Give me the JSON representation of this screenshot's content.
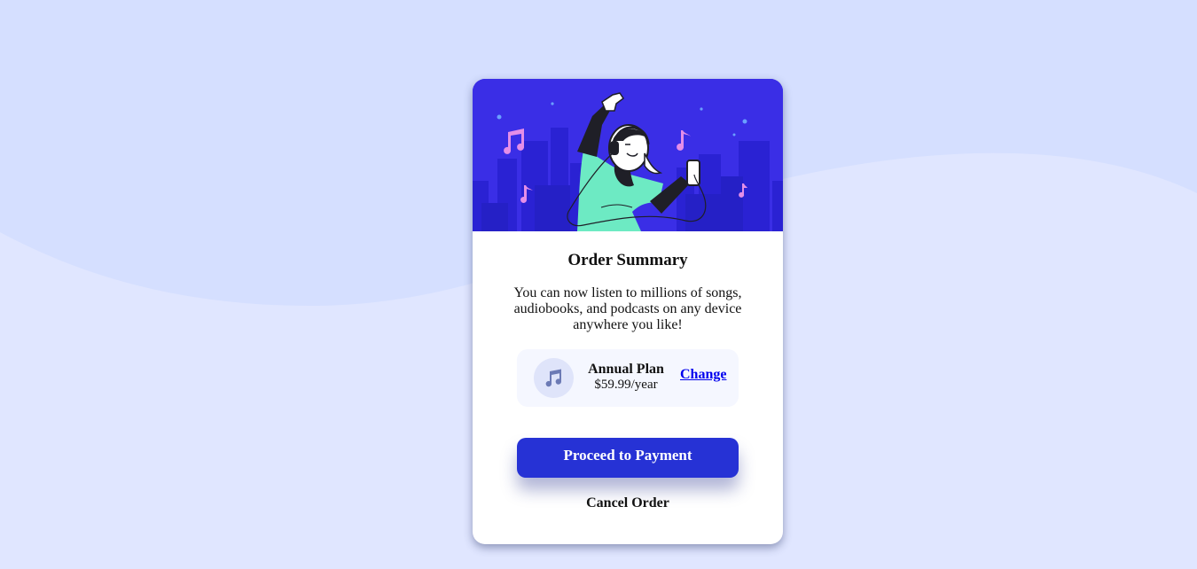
{
  "colors": {
    "page_background": "#e0e6ff",
    "wave": "#d5dfff",
    "hero_background": "#3a2ee6",
    "accent_button": "#2632d5",
    "link": "#0000ee",
    "plan_box": "#f5f7ff",
    "plan_icon_circle": "#dfe4fa"
  },
  "hero": {
    "image_icon": "person-dancing-with-headphones-illustration"
  },
  "order": {
    "title": "Order Summary",
    "description": "You can now listen to millions of songs, audiobooks, and podcasts on any device anywhere you like!"
  },
  "plan": {
    "icon": "music-note-icon",
    "name": "Annual Plan",
    "price": "$59.99/year",
    "change_label": "Change"
  },
  "actions": {
    "proceed_label": "Proceed to Payment",
    "cancel_label": "Cancel Order"
  }
}
